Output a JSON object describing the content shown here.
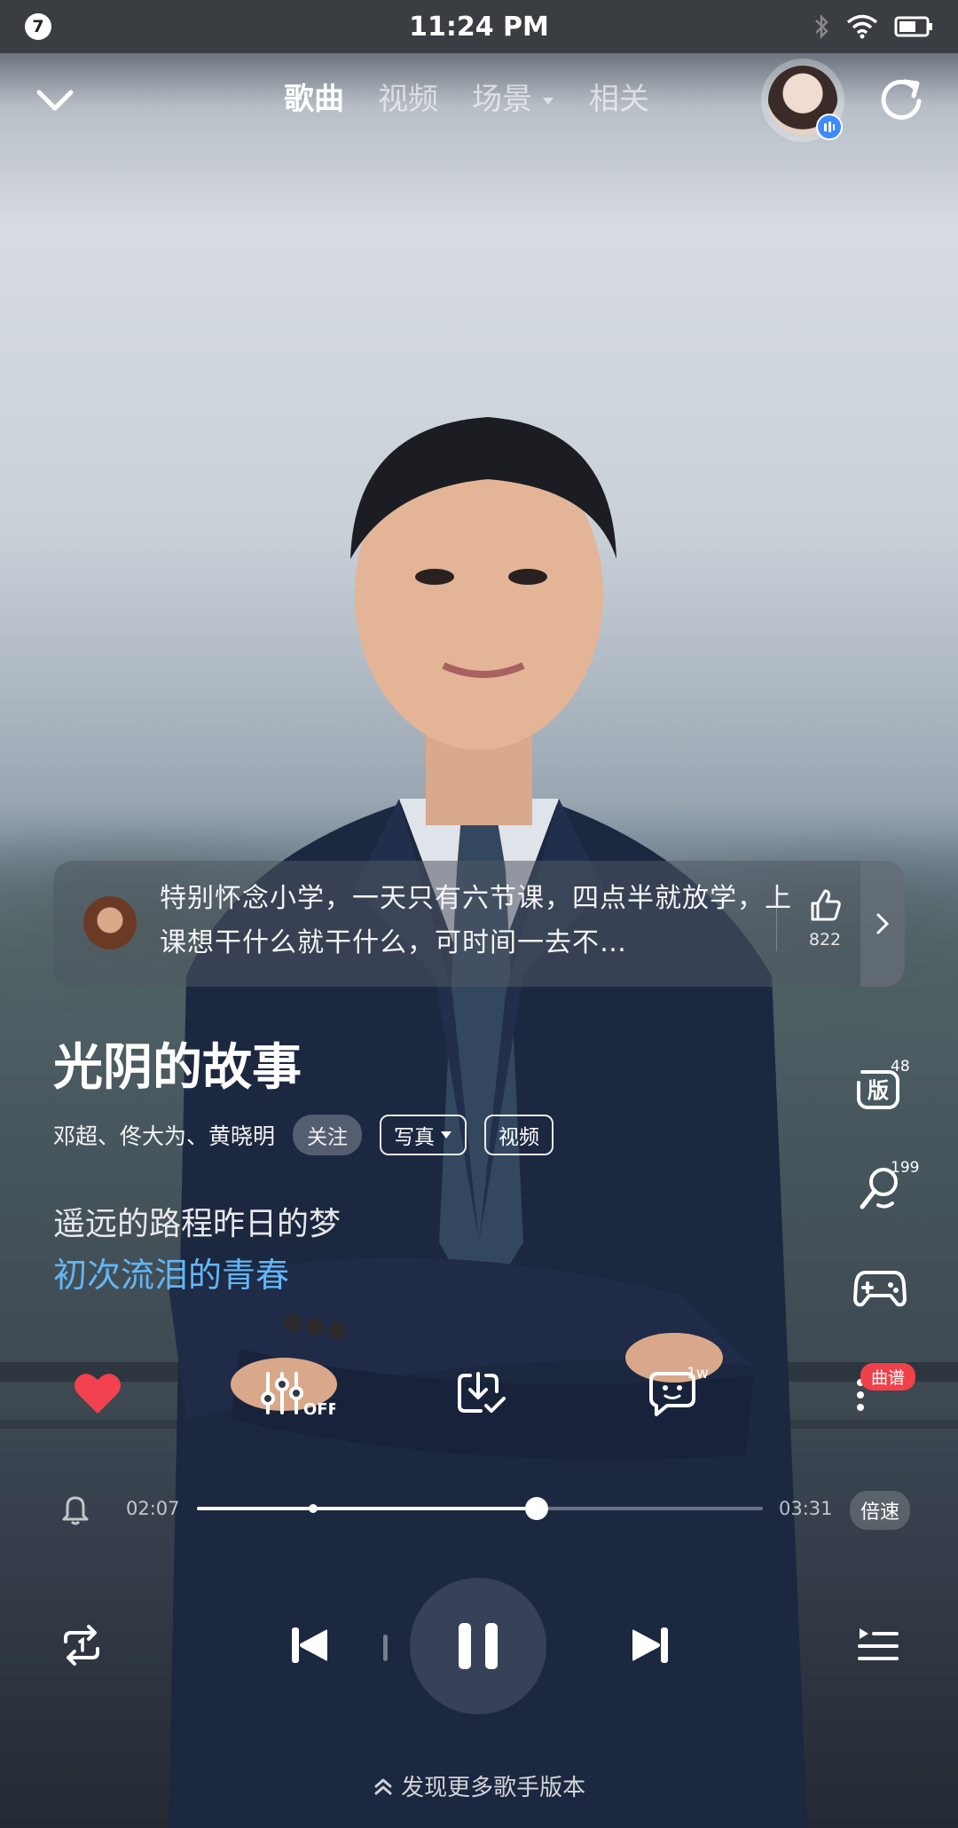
{
  "status_bar": {
    "notification_count": "7",
    "time": "11:24 PM",
    "icons": [
      "bluetooth-icon",
      "wifi-icon",
      "battery-icon"
    ]
  },
  "top_nav": {
    "tabs": [
      {
        "label": "歌曲",
        "active": true
      },
      {
        "label": "视频",
        "active": false
      },
      {
        "label": "场景",
        "active": false,
        "has_dropdown": true
      },
      {
        "label": "相关",
        "active": false
      }
    ]
  },
  "comment": {
    "text": "特别怀念小学，一天只有六节课，四点半就放学，上课想干什么就干什么，可时间一去不…",
    "likes": "822"
  },
  "song": {
    "title": "光阴的故事",
    "artists": "邓超、佟大为、黄晓明",
    "follow_label": "关注",
    "photo_label": "写真",
    "video_label": "视频"
  },
  "lyrics": {
    "previous": "遥远的路程昨日的梦",
    "current": "初次流泪的青春"
  },
  "side_actions": {
    "version_label": "版",
    "version_count": "48",
    "karaoke_count": "199"
  },
  "action_bar": {
    "comment_count": "1w",
    "score_badge": "曲谱",
    "equalizer_state": "OFF"
  },
  "playback": {
    "elapsed": "02:07",
    "duration": "03:31",
    "progress": 0.6,
    "marker": 0.205,
    "speed_label": "倍速"
  },
  "footer": {
    "discover_label": "发现更多歌手版本"
  },
  "colors": {
    "accent_lyric": "#63b6f5",
    "like_heart": "#f2424f",
    "score_badge": "#f0404a",
    "avatar_badge": "#3d8bff"
  }
}
